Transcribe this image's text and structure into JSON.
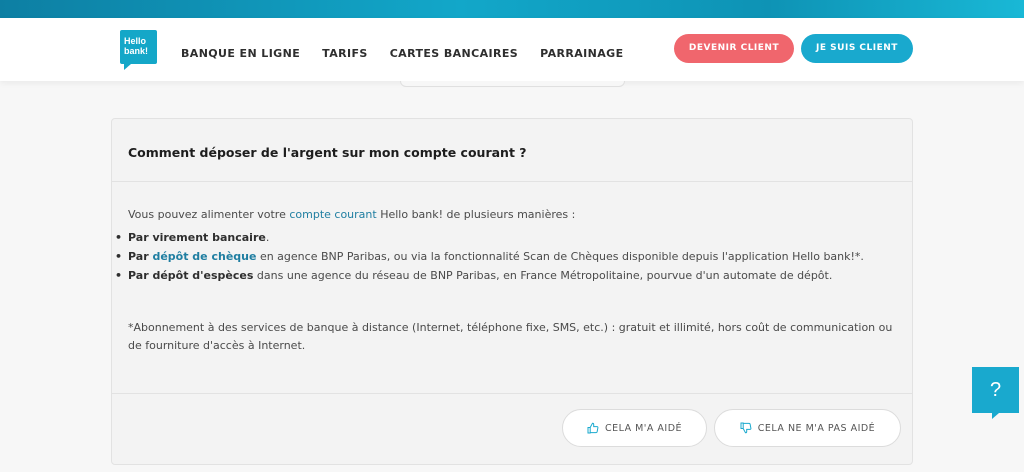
{
  "brand": {
    "logo_line1": "Hello",
    "logo_line2": "bank!",
    "accent": "#19a9ce",
    "cta_red": "#f0666d"
  },
  "nav": {
    "items": [
      "BANQUE EN LIGNE",
      "TARIFS",
      "CARTES BANCAIRES",
      "PARRAINAGE"
    ]
  },
  "header_buttons": {
    "devenir_client": "DEVENIR CLIENT",
    "je_suis_client": "JE SUIS CLIENT"
  },
  "faq": {
    "question": "Comment déposer de l'argent sur mon compte courant ?",
    "intro_before": "Vous pouvez alimenter votre ",
    "intro_link": "compte courant",
    "intro_after": " Hello bank! de plusieurs manières :",
    "bullet1_bold": "Par virement bancaire",
    "bullet1_rest": ".",
    "bullet2_bold": "Par ",
    "bullet2_link": "dépôt de chèque",
    "bullet2_rest": " en agence BNP Paribas, ou via la fonctionnalité Scan de Chèques disponible depuis l'application Hello bank!*.",
    "bullet3_bold": "Par dépôt d'espèces",
    "bullet3_rest": " dans une agence du réseau de BNP Paribas, en France Métropolitaine, pourvue d'un automate de dépôt.",
    "footnote": "*Abonnement à des services de banque à distance (Internet, téléphone fixe, SMS, etc.) : gratuit et illimité, hors coût de communication ou de fourniture d'accès à Internet."
  },
  "feedback": {
    "helped": "CELA M'A AIDÉ",
    "not_helped": "CELA NE M'A PAS AIDÉ"
  },
  "help_widget": {
    "label": "?"
  }
}
